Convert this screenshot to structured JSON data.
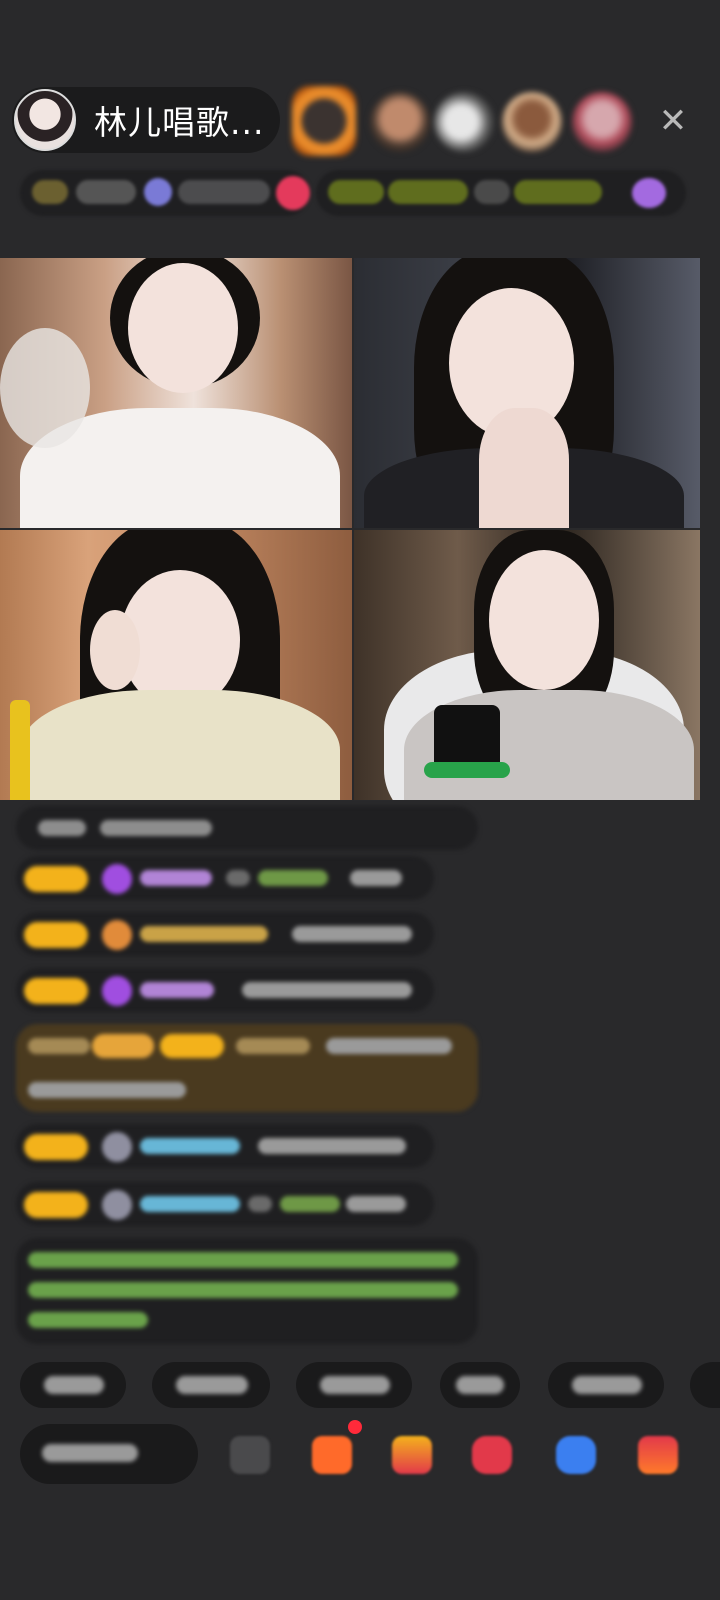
{
  "header": {
    "host_name": "林儿唱歌...",
    "close_glyph": "✕",
    "viewer_avatars": [
      {
        "name": "viewer-avatar-1",
        "ring_color": "#e88a2a"
      },
      {
        "name": "viewer-avatar-2"
      },
      {
        "name": "viewer-avatar-3"
      },
      {
        "name": "viewer-avatar-4"
      },
      {
        "name": "viewer-avatar-5"
      }
    ]
  },
  "video_grid": {
    "tiles": [
      "video-tile-1",
      "video-tile-2",
      "video-tile-3",
      "video-tile-4"
    ]
  },
  "chat": {
    "badge_color": "#f3b21b",
    "username_colors": [
      "#b184d6",
      "#c9a247",
      "#67b6d6",
      "#78b65a"
    ],
    "system_message_color": "#8bd16f"
  },
  "bottom_bar": {
    "icons": [
      "share-icon",
      "gift-box-icon",
      "gift-icon",
      "red-packet-icon",
      "game-icon",
      "more-icon"
    ],
    "accent_colors": [
      "#ff6a2a",
      "#f4b21c",
      "#e2394a",
      "#3b7ff0",
      "#e2394a"
    ]
  }
}
